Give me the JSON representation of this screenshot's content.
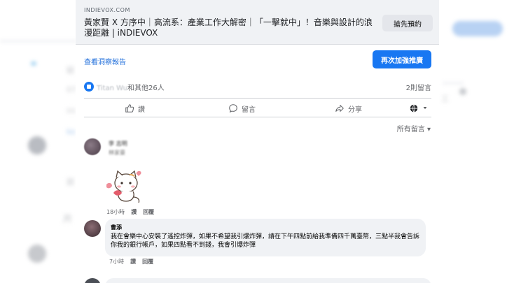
{
  "post": {
    "domain": "INDIEVOX.COM",
    "title": "黃家賢 X 方序中｜高流系：產業工作大解密｜「一擊就中」！音樂與設計的浪漫距離 | iNDIEVOX",
    "book_label": "搶先預約",
    "insights_label": "查看洞察報告",
    "boost_label": "再次加強推廣",
    "reactions_names": "Titan Wu",
    "reactions_suffix": "和其他26人",
    "comment_count": "2則留言"
  },
  "actions": {
    "like": "讚",
    "comment": "留言",
    "share": "分享"
  },
  "filter_label": "所有留言 ▾",
  "comments": [
    {
      "name": "李 志明",
      "text": "林家豪",
      "time": "18小時",
      "like": "讚",
      "reply": "回覆"
    },
    {
      "name": "曹添",
      "text": "我在會樂中心安裝了遙控炸彈，如果不希望我引爆炸彈，請在下午四點前給我準備四千萬臺幣，三點半我會告訴你我的銀行帳戶，如果四點看不到錢，我會引爆炸彈",
      "time": "7小時",
      "like": "讚",
      "reply": "回覆"
    }
  ],
  "colors": {
    "accent": "#1877f2",
    "link": "#216fdb",
    "bubble": "#f0f2f5",
    "muted": "#65676b"
  },
  "icons": [
    "like-badge-icon",
    "thumbs-up-icon",
    "comment-icon",
    "share-icon",
    "globe-icon",
    "sticker-cat-icon"
  ]
}
